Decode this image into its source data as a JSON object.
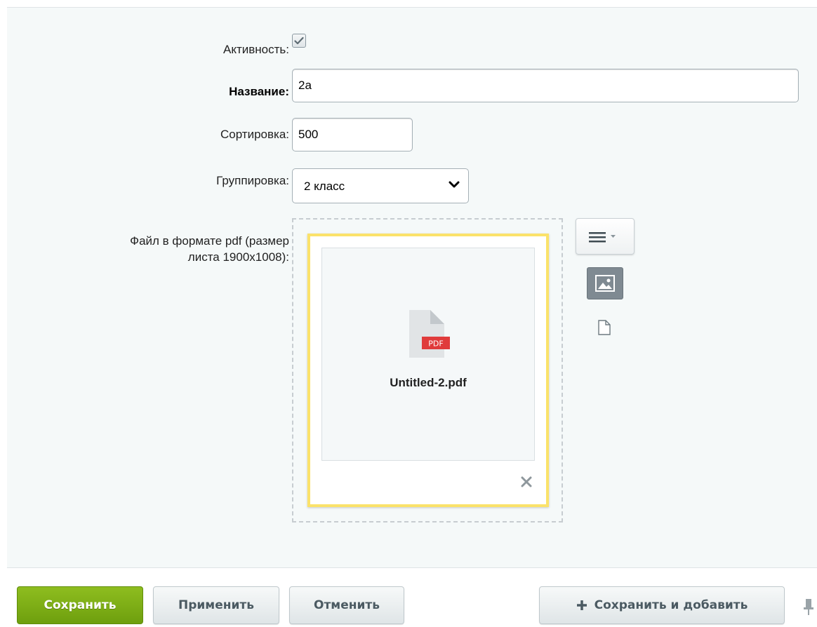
{
  "form": {
    "active_label": "Активность:",
    "active_checked": true,
    "name_label": "Название:",
    "name_value": "2а",
    "sort_label": "Сортировка:",
    "sort_value": "500",
    "group_label": "Группировка:",
    "group_value": "2 класс",
    "file_label_line1": "Файл в формате pdf (размер",
    "file_label_line2": "листа 1900x1008):"
  },
  "file": {
    "name": "Untitled-2.pdf",
    "badge": "PDF",
    "badge_color": "#e03b3b",
    "highlight_color": "#fbe26a",
    "icons": [
      "menu-dropdown-icon",
      "image-mode-icon",
      "file-mode-icon",
      "close-icon",
      "pdf-file-icon"
    ]
  },
  "footer": {
    "save_label": "Сохранить",
    "apply_label": "Применить",
    "cancel_label": "Отменить",
    "save_add_label": "Сохранить и добавить",
    "accent_color": "#7aaa14"
  }
}
